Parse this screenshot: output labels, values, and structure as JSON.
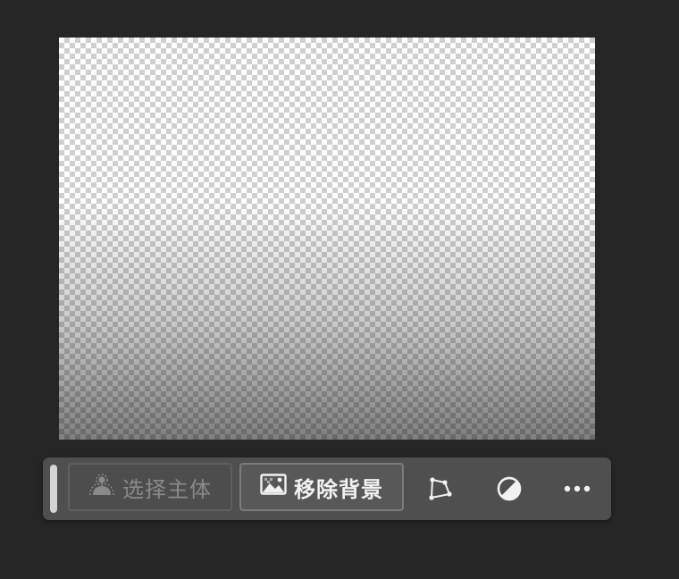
{
  "canvas": {
    "state": "transparent-background"
  },
  "taskbar": {
    "select_subject": {
      "label": "选择主体",
      "icon": "person-selection-icon",
      "enabled": false
    },
    "remove_background": {
      "label": "移除背景",
      "icon": "image-icon",
      "enabled": true
    },
    "tools": [
      {
        "name": "path-tool",
        "icon": "polygon-path-icon"
      },
      {
        "name": "adjust",
        "icon": "half-circle-icon"
      },
      {
        "name": "more",
        "icon": "more-icon"
      }
    ]
  },
  "colors": {
    "app_background": "#262626",
    "taskbar_background": "#4f4f4f",
    "active_text": "#f2f2f2",
    "disabled_text": "#8a8a8a"
  }
}
